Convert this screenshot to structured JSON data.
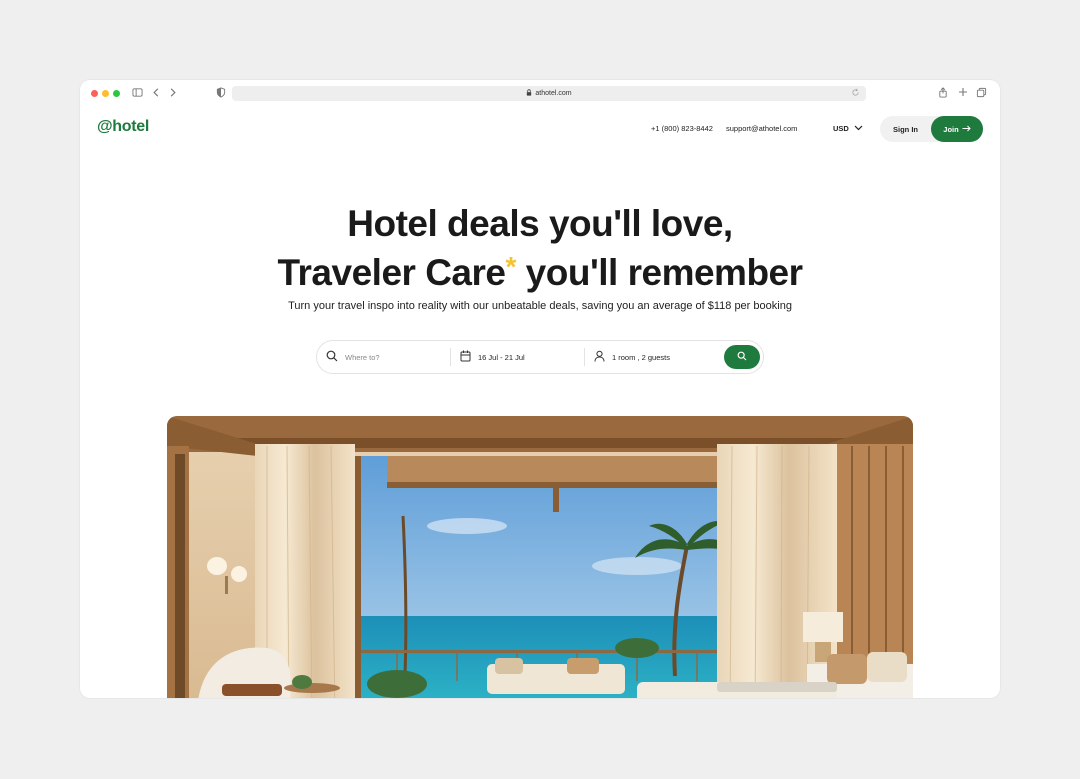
{
  "browser": {
    "url": "athotel.com"
  },
  "header": {
    "logo": "@hotel",
    "phone": "+1 (800) 823-8442",
    "email": "support@athotel.com",
    "currency": "USD",
    "sign_in": "Sign In",
    "join": "Join"
  },
  "hero": {
    "headline_line1": "Hotel deals you'll love,",
    "headline_line2_part1": "Traveler Care",
    "headline_asterisk": "*",
    "headline_line2_part2": " you'll remember",
    "subtitle": "Turn your travel inspo into reality with our unbeatable deals, saving you an average of $118 per booking"
  },
  "search": {
    "destination_placeholder": "Where to?",
    "dates": "16 Jul - 21 Jul",
    "guests": "1 room , 2 guests"
  },
  "colors": {
    "brand_green": "#1f7a3e",
    "accent_yellow": "#f5c32c"
  },
  "icons": {
    "back": "chevron-left-icon",
    "forward": "chevron-right-icon",
    "search": "search-icon",
    "calendar": "calendar-icon",
    "person": "person-icon"
  }
}
